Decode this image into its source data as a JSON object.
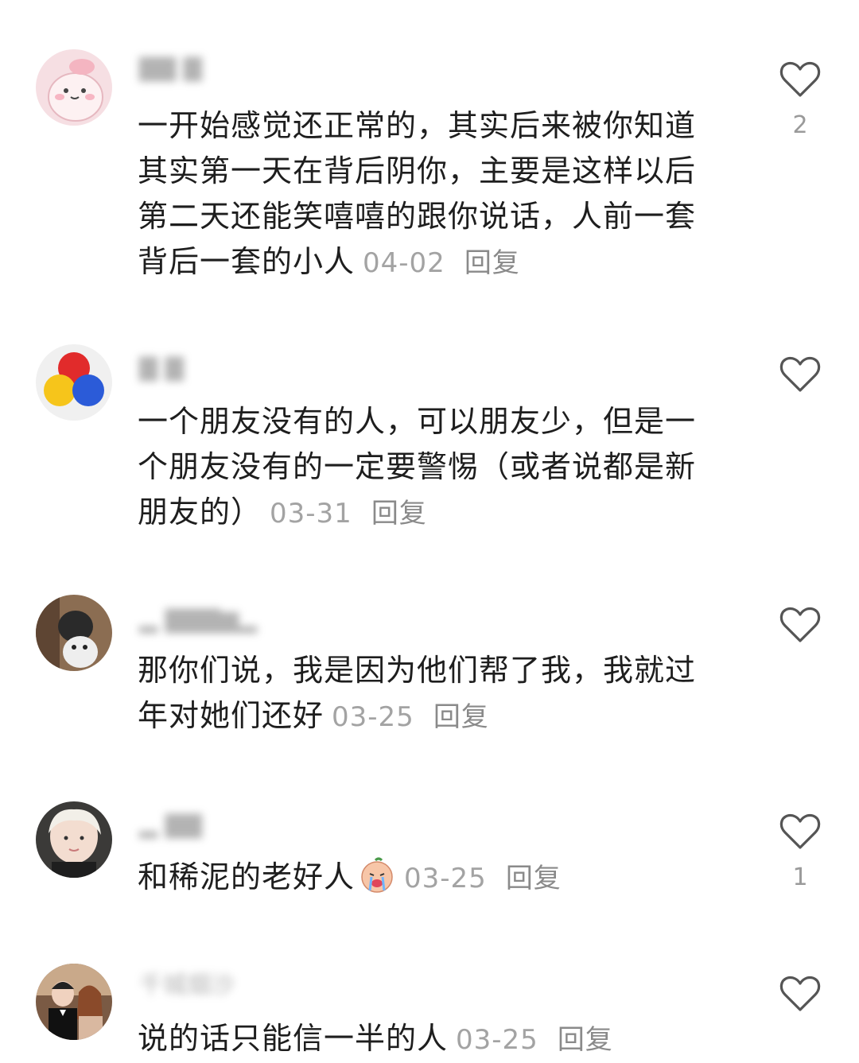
{
  "comments": [
    {
      "username": "▇▇ ▇",
      "text": "一开始感觉还正常的，其实后来被你知道其实第一天在背后阴你，主要是这样以后第二天还能笑嘻嘻的跟你说话，人前一套背后一套的小人",
      "date": "04-02",
      "reply_label": "回复",
      "likes": "2"
    },
    {
      "username": "▇ ▇",
      "text": "一个朋友没有的人，可以朋友少，但是一个朋友没有的一定要警惕（或者说都是新朋友的）",
      "date": "03-31",
      "reply_label": "回复",
      "likes": ""
    },
    {
      "username": "▂ ▇▇▇▆▂",
      "text": "那你们说，我是因为他们帮了我，我就过年对她们还好",
      "date": "03-25",
      "reply_label": "回复",
      "likes": ""
    },
    {
      "username": "▂ ▇▇",
      "text": "和稀泥的老好人",
      "date": "03-25",
      "reply_label": "回复",
      "likes": "1"
    },
    {
      "username": "千城烟沙",
      "text": "说的话只能信一半的人",
      "date": "03-25",
      "reply_label": "回复",
      "likes": ""
    }
  ],
  "colors": {
    "text": "#1e1e1e",
    "meta": "#a3a3a3",
    "heart_outline": "#555555"
  },
  "icons": {
    "like": "heart-outline-icon",
    "emoji": "crying-face-emoji-icon"
  }
}
